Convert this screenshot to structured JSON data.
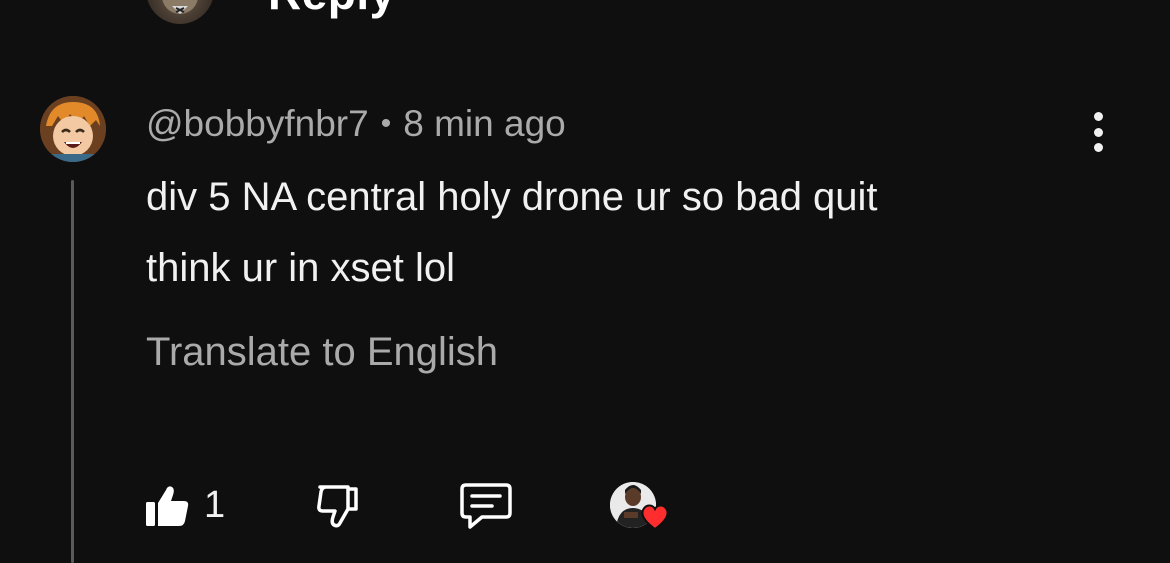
{
  "previous_reply": {
    "label": "Reply"
  },
  "comment": {
    "author": "@bobbyfnbr7",
    "separator": "•",
    "timestamp": "8 min ago",
    "text_lines": [
      "div 5 NA central holy drone ur so bad quit",
      "think ur in xset lol"
    ],
    "translate_label": "Translate to English",
    "likes": "1"
  },
  "colors": {
    "background": "#0f0f0f",
    "primary_text": "#f1f1f1",
    "secondary_text": "#aaaaaa",
    "heart": "#ff2d2d"
  },
  "icons": {
    "more": "more-vertical-icon",
    "like": "thumbs-up-icon",
    "dislike": "thumbs-down-icon",
    "reply": "comment-icon",
    "creator_heart": "heart-icon"
  }
}
